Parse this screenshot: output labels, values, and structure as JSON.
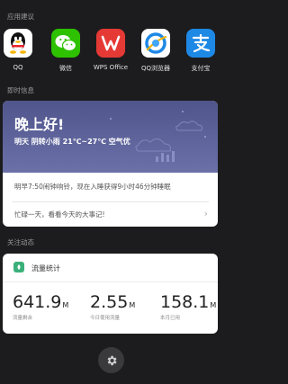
{
  "sections": {
    "suggestions_title": "应用建议",
    "instant_title": "即时信息",
    "follow_title": "关注动态"
  },
  "apps": [
    {
      "label": "QQ",
      "icon": "qq-icon"
    },
    {
      "label": "微信",
      "icon": "wechat-icon"
    },
    {
      "label": "WPS Office",
      "icon": "wps-office-icon"
    },
    {
      "label": "QQ浏览器",
      "icon": "qq-browser-icon"
    },
    {
      "label": "支付宝",
      "icon": "alipay-icon"
    }
  ],
  "weather": {
    "greeting": "晚上好!",
    "forecast": "明天  阴转小雨  21℃~27℃  空气优",
    "alarm": "明早7:50闹钟响铃，现在入睡获得9小时46分钟睡眠",
    "memo": "忙碌一天，看看今天的大事记!",
    "colors": {
      "top": "#50558c",
      "bottom": "#6b71a8"
    }
  },
  "traffic": {
    "title": "流量统计",
    "stats": [
      {
        "value": "641.9",
        "unit": "M",
        "caption": "流量剩余"
      },
      {
        "value": "2.55",
        "unit": "M",
        "caption": "今日使用流量"
      },
      {
        "value": "158.1",
        "unit": "M",
        "caption": "本月已用"
      }
    ],
    "accent": "#3bb07a"
  },
  "settings": {
    "icon": "gear-icon"
  }
}
